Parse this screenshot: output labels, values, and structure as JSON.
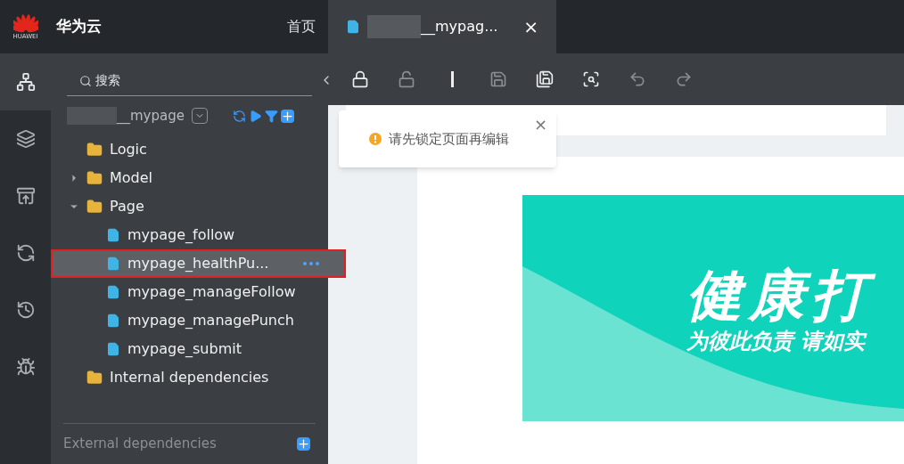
{
  "brand": {
    "logo_text": "HUAWEI",
    "name": "华为云",
    "home_link": "首页"
  },
  "rail": [
    {
      "kind": "tree",
      "selected": true
    },
    {
      "kind": "layers",
      "selected": false
    },
    {
      "kind": "archive",
      "selected": false
    },
    {
      "kind": "cycle",
      "selected": false
    },
    {
      "kind": "history",
      "selected": false
    },
    {
      "kind": "debug",
      "selected": false
    }
  ],
  "search": {
    "placeholder": "搜索"
  },
  "project": {
    "name": "__mypage"
  },
  "tree": [
    {
      "label": "Logic",
      "kind": "folder"
    },
    {
      "label": "Model",
      "kind": "folder",
      "expanded": false
    },
    {
      "label": "Page",
      "kind": "folder",
      "expanded": true,
      "children": [
        {
          "label": "mypage_follow",
          "kind": "file",
          "selected": false
        },
        {
          "label": "mypage_healthPu...",
          "kind": "file",
          "selected": true
        },
        {
          "label": "mypage_manageFollow",
          "kind": "file",
          "selected": false
        },
        {
          "label": "mypage_managePunch",
          "kind": "file",
          "selected": false
        },
        {
          "label": "mypage_submit",
          "kind": "file",
          "selected": false
        }
      ]
    },
    {
      "label": "Internal dependencies",
      "kind": "folder"
    }
  ],
  "external": {
    "label": "External dependencies"
  },
  "tab": {
    "title": "__mypag...",
    "close": "×"
  },
  "toolbar": [
    {
      "kind": "lock",
      "disabled": false
    },
    {
      "kind": "unlock",
      "disabled": true
    },
    {
      "kind": "cursor",
      "disabled": false
    },
    {
      "kind": "save",
      "disabled": true
    },
    {
      "kind": "save-all",
      "disabled": false
    },
    {
      "kind": "preview",
      "disabled": false
    },
    {
      "kind": "undo",
      "disabled": true
    },
    {
      "kind": "redo",
      "disabled": true
    }
  ],
  "toast": {
    "message": "请先锁定页面再编辑",
    "close": "×"
  },
  "banner": {
    "title": "健康打",
    "subtitle": "为彼此负责 请如实"
  }
}
